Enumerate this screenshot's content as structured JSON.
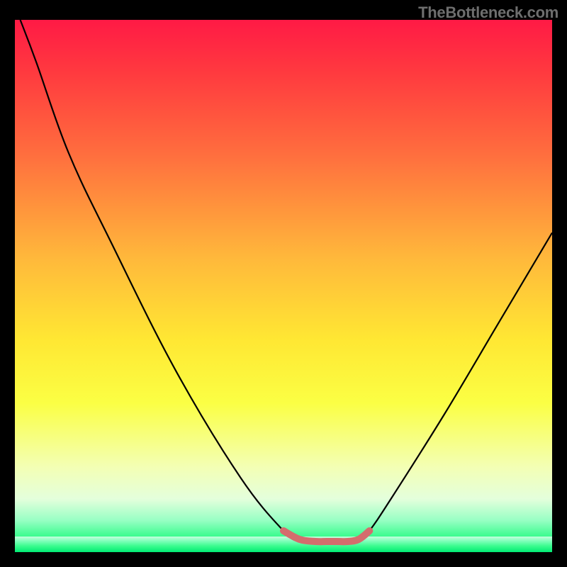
{
  "attribution": "TheBottleneck.com",
  "chart_data": {
    "type": "line",
    "title": "",
    "xlabel": "",
    "ylabel": "",
    "xlim": [
      0,
      100
    ],
    "ylim": [
      0,
      100
    ],
    "series": [
      {
        "name": "bottleneck-curve",
        "x": [
          1,
          4,
          10,
          18,
          30,
          42,
          50,
          53,
          56,
          60,
          64,
          66,
          70,
          80,
          90,
          100
        ],
        "y": [
          100,
          92,
          75,
          58,
          34,
          14,
          4,
          2,
          1.6,
          1.6,
          2,
          4,
          10,
          26,
          43,
          60
        ]
      },
      {
        "name": "optimal-zone",
        "x": [
          50,
          53,
          56,
          58,
          60,
          62,
          64,
          66
        ],
        "y": [
          4,
          2.4,
          2,
          2,
          2,
          2,
          2.4,
          4
        ]
      }
    ],
    "background_gradient": {
      "orientation": "vertical-top-to-bottom",
      "stops": [
        {
          "pos": 0.0,
          "color": "#ff1a45"
        },
        {
          "pos": 0.25,
          "color": "#ff6d3e"
        },
        {
          "pos": 0.45,
          "color": "#ffb93b"
        },
        {
          "pos": 0.72,
          "color": "#fbff44"
        },
        {
          "pos": 0.9,
          "color": "#e4ffdc"
        },
        {
          "pos": 1.0,
          "color": "#00eb73"
        }
      ]
    }
  }
}
